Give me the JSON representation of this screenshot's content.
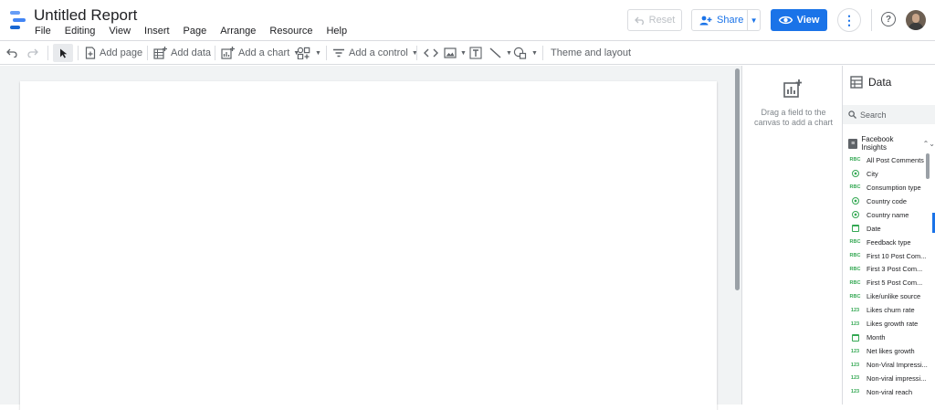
{
  "app": {
    "title": "Untitled Report",
    "menu": [
      "File",
      "Editing",
      "View",
      "Insert",
      "Page",
      "Arrange",
      "Resource",
      "Help"
    ],
    "colors": {
      "accent": "#1a73e8",
      "field_dimension": "#34a853"
    }
  },
  "header": {
    "reset_label": "Reset",
    "share_label": "Share",
    "view_label": "View"
  },
  "toolbar": {
    "add_page": "Add page",
    "add_data": "Add data",
    "add_chart": "Add a chart",
    "add_control": "Add a control",
    "theme_layout": "Theme and layout"
  },
  "properties": {
    "hint": "Drag a field to the canvas to add a chart"
  },
  "data_panel": {
    "title": "Data",
    "search_placeholder": "Search",
    "data_source": "Facebook Insights",
    "fields": [
      {
        "name": "All Post Comments",
        "type": "text"
      },
      {
        "name": "City",
        "type": "geo"
      },
      {
        "name": "Consumption type",
        "type": "text"
      },
      {
        "name": "Country code",
        "type": "geo"
      },
      {
        "name": "Country name",
        "type": "geo"
      },
      {
        "name": "Date",
        "type": "date"
      },
      {
        "name": "Feedback type",
        "type": "text"
      },
      {
        "name": "First 10 Post Com...",
        "type": "text"
      },
      {
        "name": "First 3 Post Com...",
        "type": "text"
      },
      {
        "name": "First 5 Post Com...",
        "type": "text"
      },
      {
        "name": "Like/unlike source",
        "type": "text"
      },
      {
        "name": "Likes churn rate",
        "type": "number"
      },
      {
        "name": "Likes growth rate",
        "type": "number"
      },
      {
        "name": "Month",
        "type": "date"
      },
      {
        "name": "Net likes growth",
        "type": "number"
      },
      {
        "name": "Non-Viral Impressi...",
        "type": "number"
      },
      {
        "name": "Non-viral impressi...",
        "type": "number"
      },
      {
        "name": "Non-viral reach",
        "type": "number"
      }
    ],
    "type_labels": {
      "text": "RBC",
      "number": "123"
    }
  }
}
